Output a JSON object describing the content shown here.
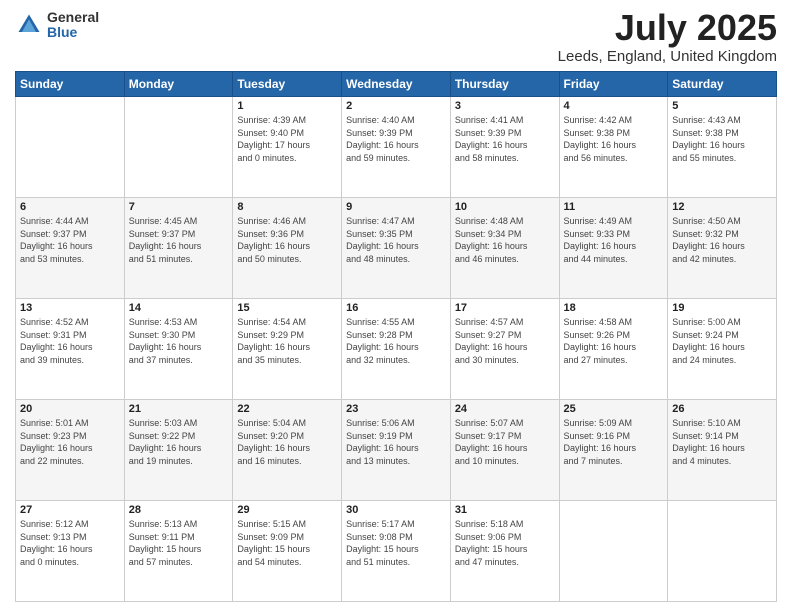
{
  "header": {
    "logo_general": "General",
    "logo_blue": "Blue",
    "title": "July 2025",
    "location": "Leeds, England, United Kingdom"
  },
  "days_of_week": [
    "Sunday",
    "Monday",
    "Tuesday",
    "Wednesday",
    "Thursday",
    "Friday",
    "Saturday"
  ],
  "weeks": [
    [
      {
        "day": "",
        "info": ""
      },
      {
        "day": "",
        "info": ""
      },
      {
        "day": "1",
        "info": "Sunrise: 4:39 AM\nSunset: 9:40 PM\nDaylight: 17 hours\nand 0 minutes."
      },
      {
        "day": "2",
        "info": "Sunrise: 4:40 AM\nSunset: 9:39 PM\nDaylight: 16 hours\nand 59 minutes."
      },
      {
        "day": "3",
        "info": "Sunrise: 4:41 AM\nSunset: 9:39 PM\nDaylight: 16 hours\nand 58 minutes."
      },
      {
        "day": "4",
        "info": "Sunrise: 4:42 AM\nSunset: 9:38 PM\nDaylight: 16 hours\nand 56 minutes."
      },
      {
        "day": "5",
        "info": "Sunrise: 4:43 AM\nSunset: 9:38 PM\nDaylight: 16 hours\nand 55 minutes."
      }
    ],
    [
      {
        "day": "6",
        "info": "Sunrise: 4:44 AM\nSunset: 9:37 PM\nDaylight: 16 hours\nand 53 minutes."
      },
      {
        "day": "7",
        "info": "Sunrise: 4:45 AM\nSunset: 9:37 PM\nDaylight: 16 hours\nand 51 minutes."
      },
      {
        "day": "8",
        "info": "Sunrise: 4:46 AM\nSunset: 9:36 PM\nDaylight: 16 hours\nand 50 minutes."
      },
      {
        "day": "9",
        "info": "Sunrise: 4:47 AM\nSunset: 9:35 PM\nDaylight: 16 hours\nand 48 minutes."
      },
      {
        "day": "10",
        "info": "Sunrise: 4:48 AM\nSunset: 9:34 PM\nDaylight: 16 hours\nand 46 minutes."
      },
      {
        "day": "11",
        "info": "Sunrise: 4:49 AM\nSunset: 9:33 PM\nDaylight: 16 hours\nand 44 minutes."
      },
      {
        "day": "12",
        "info": "Sunrise: 4:50 AM\nSunset: 9:32 PM\nDaylight: 16 hours\nand 42 minutes."
      }
    ],
    [
      {
        "day": "13",
        "info": "Sunrise: 4:52 AM\nSunset: 9:31 PM\nDaylight: 16 hours\nand 39 minutes."
      },
      {
        "day": "14",
        "info": "Sunrise: 4:53 AM\nSunset: 9:30 PM\nDaylight: 16 hours\nand 37 minutes."
      },
      {
        "day": "15",
        "info": "Sunrise: 4:54 AM\nSunset: 9:29 PM\nDaylight: 16 hours\nand 35 minutes."
      },
      {
        "day": "16",
        "info": "Sunrise: 4:55 AM\nSunset: 9:28 PM\nDaylight: 16 hours\nand 32 minutes."
      },
      {
        "day": "17",
        "info": "Sunrise: 4:57 AM\nSunset: 9:27 PM\nDaylight: 16 hours\nand 30 minutes."
      },
      {
        "day": "18",
        "info": "Sunrise: 4:58 AM\nSunset: 9:26 PM\nDaylight: 16 hours\nand 27 minutes."
      },
      {
        "day": "19",
        "info": "Sunrise: 5:00 AM\nSunset: 9:24 PM\nDaylight: 16 hours\nand 24 minutes."
      }
    ],
    [
      {
        "day": "20",
        "info": "Sunrise: 5:01 AM\nSunset: 9:23 PM\nDaylight: 16 hours\nand 22 minutes."
      },
      {
        "day": "21",
        "info": "Sunrise: 5:03 AM\nSunset: 9:22 PM\nDaylight: 16 hours\nand 19 minutes."
      },
      {
        "day": "22",
        "info": "Sunrise: 5:04 AM\nSunset: 9:20 PM\nDaylight: 16 hours\nand 16 minutes."
      },
      {
        "day": "23",
        "info": "Sunrise: 5:06 AM\nSunset: 9:19 PM\nDaylight: 16 hours\nand 13 minutes."
      },
      {
        "day": "24",
        "info": "Sunrise: 5:07 AM\nSunset: 9:17 PM\nDaylight: 16 hours\nand 10 minutes."
      },
      {
        "day": "25",
        "info": "Sunrise: 5:09 AM\nSunset: 9:16 PM\nDaylight: 16 hours\nand 7 minutes."
      },
      {
        "day": "26",
        "info": "Sunrise: 5:10 AM\nSunset: 9:14 PM\nDaylight: 16 hours\nand 4 minutes."
      }
    ],
    [
      {
        "day": "27",
        "info": "Sunrise: 5:12 AM\nSunset: 9:13 PM\nDaylight: 16 hours\nand 0 minutes."
      },
      {
        "day": "28",
        "info": "Sunrise: 5:13 AM\nSunset: 9:11 PM\nDaylight: 15 hours\nand 57 minutes."
      },
      {
        "day": "29",
        "info": "Sunrise: 5:15 AM\nSunset: 9:09 PM\nDaylight: 15 hours\nand 54 minutes."
      },
      {
        "day": "30",
        "info": "Sunrise: 5:17 AM\nSunset: 9:08 PM\nDaylight: 15 hours\nand 51 minutes."
      },
      {
        "day": "31",
        "info": "Sunrise: 5:18 AM\nSunset: 9:06 PM\nDaylight: 15 hours\nand 47 minutes."
      },
      {
        "day": "",
        "info": ""
      },
      {
        "day": "",
        "info": ""
      }
    ]
  ]
}
